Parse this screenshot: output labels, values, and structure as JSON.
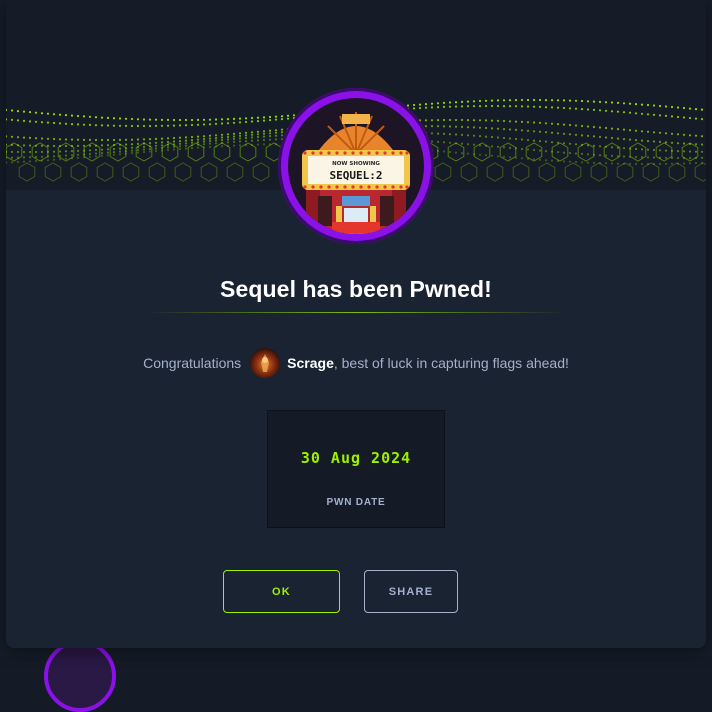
{
  "modal": {
    "title": "Sequel has been Pwned!",
    "machine_avatar": {
      "marquee_small": "NOW SHOWING",
      "marquee_big": "SEQUEL:2"
    },
    "congrats": {
      "prefix": "Congratulations",
      "username": "Scrage",
      "suffix": ", best of luck in capturing flags ahead!"
    },
    "pwn": {
      "date": "30 Aug 2024",
      "label": "PWN DATE"
    },
    "buttons": {
      "ok_label": "OK",
      "share_label": "SHARE"
    }
  },
  "colors": {
    "accent_green": "#9fef00",
    "avatar_ring": "#8a12e8",
    "modal_bg": "#1a2332",
    "muted_text": "#a4b1cd"
  }
}
